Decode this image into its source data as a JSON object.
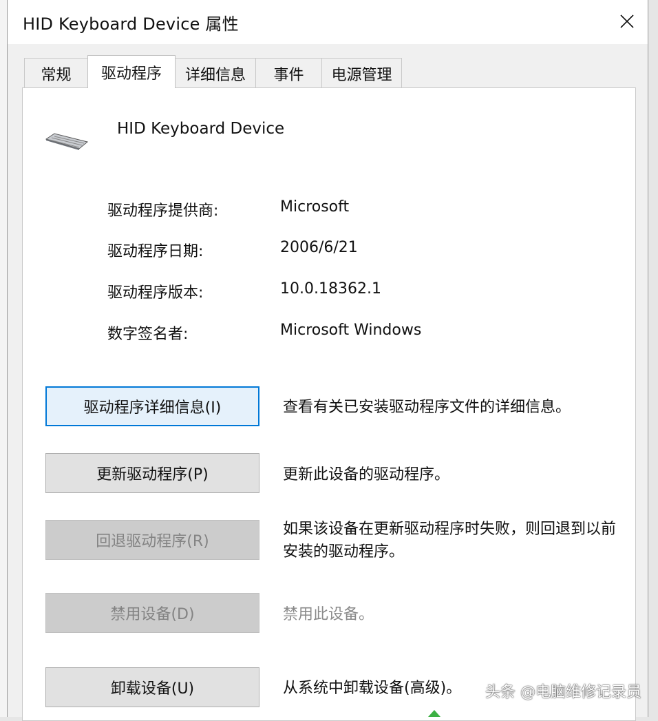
{
  "window": {
    "title": "HID Keyboard Device 属性"
  },
  "tabs": [
    {
      "label": "常规",
      "active": false
    },
    {
      "label": "驱动程序",
      "active": true
    },
    {
      "label": "详细信息",
      "active": false
    },
    {
      "label": "事件",
      "active": false
    },
    {
      "label": "电源管理",
      "active": false
    }
  ],
  "device": {
    "name": "HID Keyboard Device",
    "icon": "keyboard-icon"
  },
  "driver_info": [
    {
      "label": "驱动程序提供商:",
      "value": "Microsoft"
    },
    {
      "label": "驱动程序日期:",
      "value": "2006/6/21"
    },
    {
      "label": "驱动程序版本:",
      "value": "10.0.18362.1"
    },
    {
      "label": "数字签名者:",
      "value": "Microsoft Windows"
    }
  ],
  "actions": [
    {
      "label": "驱动程序详细信息(I)",
      "desc": "查看有关已安装驱动程序文件的详细信息。",
      "state": "focused"
    },
    {
      "label": "更新驱动程序(P)",
      "desc": "更新此设备的驱动程序。",
      "state": "normal"
    },
    {
      "label": "回退驱动程序(R)",
      "desc": "如果该设备在更新驱动程序时失败，则回退到以前安装的驱动程序。",
      "state": "disabled"
    },
    {
      "label": "禁用设备(D)",
      "desc": "禁用此设备。",
      "state": "disabled"
    },
    {
      "label": "卸载设备(U)",
      "desc": "从系统中卸载设备(高级)。",
      "state": "normal"
    }
  ],
  "watermark": "头条 @电脑维修记录员",
  "colors": {
    "focus_border": "#0078d7",
    "disabled_text": "#838383",
    "panel_bg": "#ffffff",
    "window_bg": "#f0f0f0"
  }
}
